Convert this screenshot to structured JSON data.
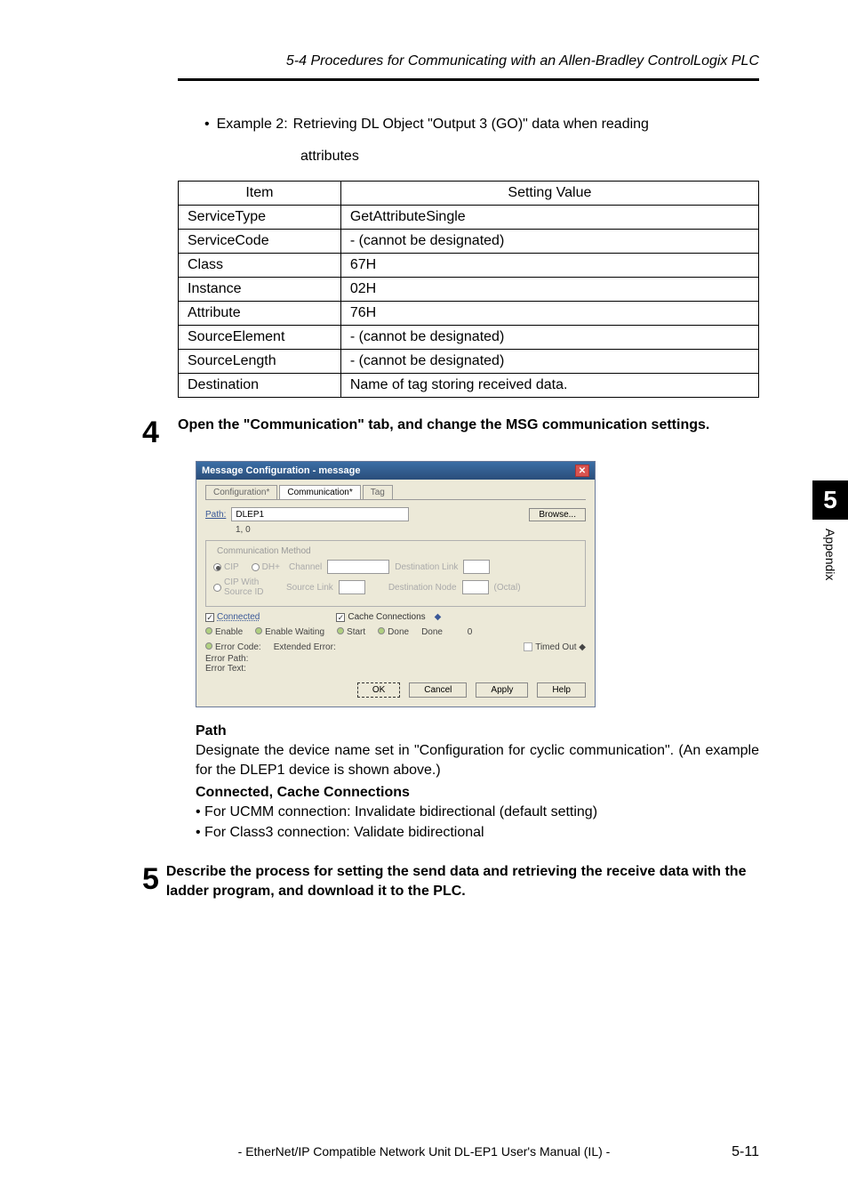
{
  "header": "5-4 Procedures for Communicating with an Allen-Bradley ControlLogix PLC",
  "example": {
    "label": "Example 2:",
    "line1": "Retrieving DL Object \"Output 3 (GO)\" data when reading",
    "line2": "attributes"
  },
  "table": {
    "head_item": "Item",
    "head_value": "Setting Value",
    "rows": [
      {
        "item": "ServiceType",
        "value": "GetAttributeSingle"
      },
      {
        "item": "ServiceCode",
        "value": "- (cannot be designated)"
      },
      {
        "item": "Class",
        "value": "67H"
      },
      {
        "item": "Instance",
        "value": "02H"
      },
      {
        "item": "Attribute",
        "value": "76H"
      },
      {
        "item": "SourceElement",
        "value": "- (cannot be designated)"
      },
      {
        "item": "SourceLength",
        "value": "- (cannot be designated)"
      },
      {
        "item": "Destination",
        "value": "Name of tag storing received data."
      }
    ]
  },
  "step4": {
    "num": "4",
    "text": "Open the \"Communication\" tab, and change the MSG communication settings."
  },
  "dialog": {
    "title": "Message Configuration - message",
    "tabs": {
      "config": "Configuration*",
      "comm": "Communication*",
      "tag": "Tag"
    },
    "path_label": "Path:",
    "path_value": "DLEP1",
    "path_sub": "1, 0",
    "browse": "Browse...",
    "comm_method": "Communication Method",
    "cip": "CIP",
    "dh": "DH+",
    "channel": "Channel",
    "dest_link": "Destination Link",
    "cip_with": "CIP With Source ID",
    "source_link": "Source Link",
    "dest_node": "Destination Node",
    "octal": "(Octal)",
    "connected": "Connected",
    "cache": "Cache Connections",
    "enable": "Enable",
    "enable_wait": "Enable Waiting",
    "start": "Start",
    "done_lbl": "Done",
    "done_val": "Done          0",
    "error_code": "Error Code:",
    "ext_err": "Extended Error:",
    "timed_out": "Timed Out",
    "err_path": "Error Path:",
    "err_text": "Error Text:",
    "ok": "OK",
    "cancel": "Cancel",
    "apply": "Apply",
    "help": "Help"
  },
  "path_head": "Path",
  "path_text": "Designate the device name set in \"Configuration for cyclic communication\". (An example for the DLEP1 device is shown above.)",
  "conn_head": "Connected, Cache Connections",
  "conn_b1": "• For UCMM connection: Invalidate bidirectional (default setting)",
  "conn_b2": "• For Class3 connection: Validate bidirectional",
  "step5": {
    "num": "5",
    "text": "Describe the process for setting the send data and retrieving the receive data with the ladder program, and download it to the PLC."
  },
  "side": {
    "num": "5",
    "text": "Appendix"
  },
  "footer": "- EtherNet/IP Compatible Network Unit DL-EP1 User's Manual (IL) -",
  "page": "5-11"
}
